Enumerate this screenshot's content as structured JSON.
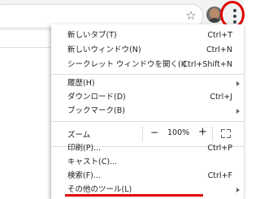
{
  "toolbar": {
    "star_icon": "star-icon",
    "profile_icon": "avatar",
    "menu_icon": "kebab-menu-icon"
  },
  "menu": {
    "new_tab": {
      "label": "新しいタブ(T)",
      "shortcut": "Ctrl+T"
    },
    "new_window": {
      "label": "新しいウィンドウ(N)",
      "shortcut": "Ctrl+N"
    },
    "incognito": {
      "label": "シークレット ウィンドウを開く(I)",
      "shortcut": "Ctrl+Shift+N"
    },
    "history": {
      "label": "履歴(H)"
    },
    "downloads": {
      "label": "ダウンロード(D)",
      "shortcut": "Ctrl+J"
    },
    "bookmarks": {
      "label": "ブックマーク(B)"
    },
    "zoom": {
      "label": "ズーム",
      "minus": "−",
      "value": "100%",
      "plus": "+"
    },
    "print": {
      "label": "印刷(P)...",
      "shortcut": "Ctrl+P"
    },
    "cast": {
      "label": "キャスト(C)..."
    },
    "find": {
      "label": "検索(F)...",
      "shortcut": "Ctrl+F"
    },
    "more_tools": {
      "label": "その他のツール(L)"
    }
  },
  "highlight_color": "#e00000"
}
